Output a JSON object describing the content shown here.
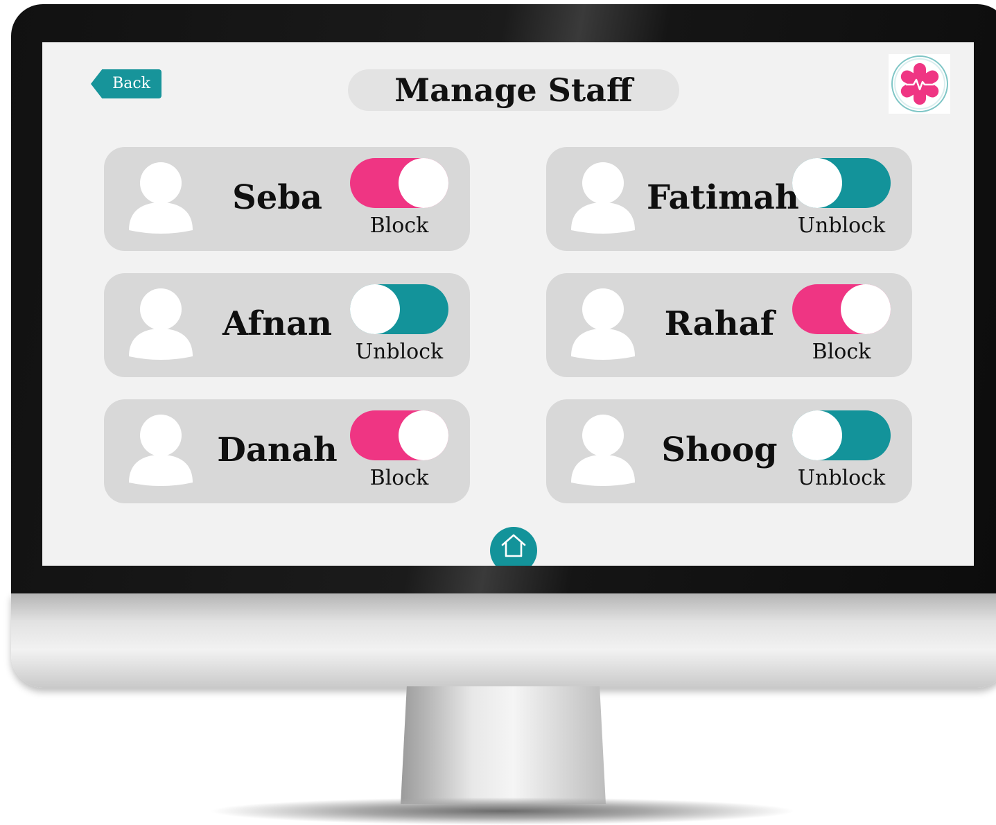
{
  "header": {
    "back_label": "Back",
    "title": "Manage Staff"
  },
  "logo": {
    "icon": "medical-star-heartbeat-icon"
  },
  "staff": [
    {
      "name": "Seba",
      "state_label": "Block",
      "toggle_color": "#ef3583"
    },
    {
      "name": "Fatimah",
      "state_label": "Unblock",
      "toggle_color": "#13939a"
    },
    {
      "name": "Afnan",
      "state_label": "Unblock",
      "toggle_color": "#13939a"
    },
    {
      "name": "Rahaf",
      "state_label": "Block",
      "toggle_color": "#ef3583"
    },
    {
      "name": "Danah",
      "state_label": "Block",
      "toggle_color": "#ef3583"
    },
    {
      "name": "Shoog",
      "state_label": "Unblock",
      "toggle_color": "#13939a"
    }
  ],
  "footer": {
    "home_icon": "home-icon"
  },
  "colors": {
    "accent_teal": "#13939a",
    "accent_pink": "#ef3583",
    "card_bg": "#d8d8d8",
    "screen_bg": "#f2f2f2"
  }
}
